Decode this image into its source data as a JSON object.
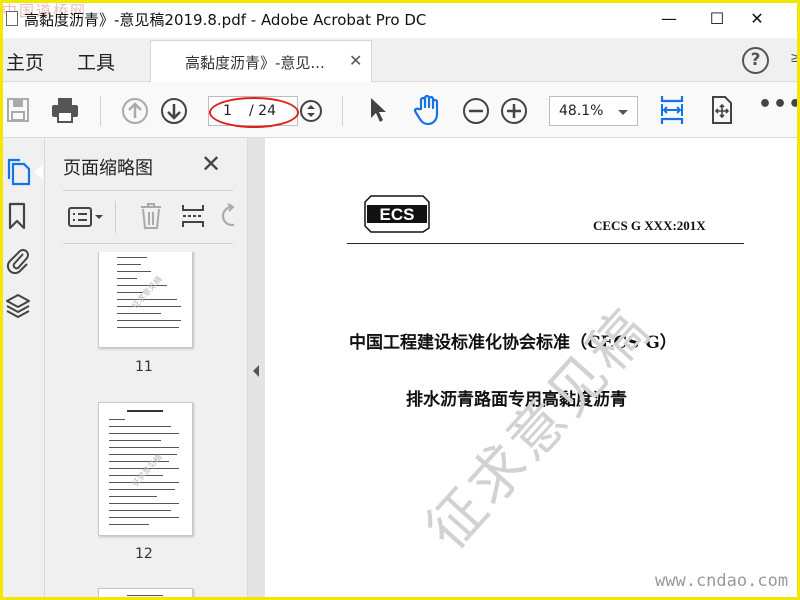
{
  "window": {
    "title": "高黏度沥青》-意见稿2019.8.pdf - Adobe Acrobat Pro DC",
    "site_watermark_top": "中国道桥网",
    "minimize": "—",
    "maximize": "☐",
    "close": "✕"
  },
  "menu": {
    "home": "主页",
    "tools": "工具",
    "doc_tab_label": "高黏度沥青》-意见...",
    "doc_tab_close": "✕",
    "help": "?",
    "edge_glyph": "≥"
  },
  "toolbar": {
    "page_current": "1",
    "page_total": "/ 24",
    "zoom_value": "48.1%",
    "more": "•••"
  },
  "thumbnails_panel": {
    "title": "页面缩略图",
    "close": "✕",
    "pages": [
      {
        "label": "11",
        "watermark": "征求意见稿"
      },
      {
        "label": "12",
        "watermark": "征求意见稿"
      }
    ]
  },
  "document": {
    "logo_text": "ECS",
    "standard_no": "CECS  G  XXX:201X",
    "heading1": "中国工程建设标准化协会标准（CECS G）",
    "heading2": "排水沥青路面专用高黏度沥青",
    "watermark": "征求意见稿"
  },
  "overlay": {
    "site_watermark": "www.cndao.com"
  },
  "colors": {
    "frame": "#f3e600",
    "annotation_ellipse": "#e0201c",
    "accent_blue": "#1473e6"
  },
  "icons": [
    "save-icon",
    "print-icon",
    "prev-page-icon",
    "next-page-icon",
    "page-nav-icon",
    "select-arrow-icon",
    "hand-icon",
    "zoom-out-icon",
    "zoom-in-icon",
    "fit-width-icon",
    "scroll-mode-icon",
    "pages-icon",
    "bookmark-icon",
    "attachment-icon",
    "layers-icon",
    "options-list-icon",
    "trash-icon",
    "extract-icon",
    "rotate-icon"
  ]
}
